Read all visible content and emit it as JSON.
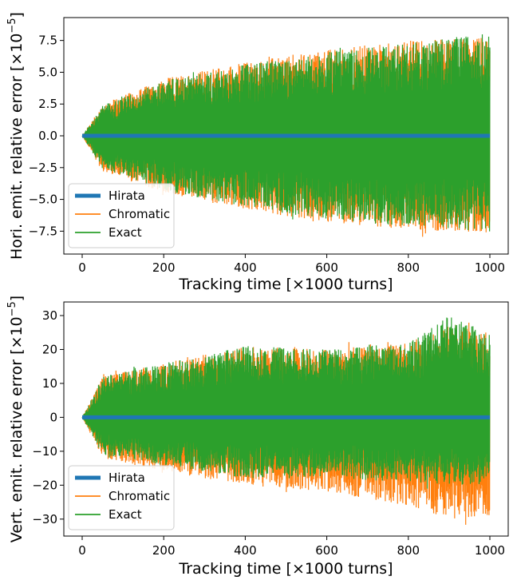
{
  "chart_data": [
    {
      "type": "line",
      "xlabel": "Tracking time [×1000 turns]",
      "ylabel": "Hori. emit. relative error [×10",
      "ylabel_exp": "−5",
      "ylabel_close": "]",
      "xlim": [
        -45,
        1045
      ],
      "ylim": [
        -9.3,
        9.3
      ],
      "xticks": [
        0,
        200,
        400,
        600,
        800,
        1000
      ],
      "xtick_labels": [
        "0",
        "200",
        "400",
        "600",
        "800",
        "1000"
      ],
      "yticks": [
        -7.5,
        -5.0,
        -2.5,
        0.0,
        2.5,
        5.0,
        7.5
      ],
      "ytick_labels": [
        "−7.5",
        "−5.0",
        "−2.5",
        "0.0",
        "2.5",
        "5.0",
        "7.5"
      ],
      "legend_position": "lower-left",
      "series": [
        {
          "name": "Hirata",
          "color": "#1f77b4",
          "values_summary": "constant 0 for x in [0, 1000]"
        },
        {
          "name": "Chromatic",
          "color": "#ff7f0e",
          "envelope": {
            "x": [
              0,
              50,
              200,
              400,
              600,
              800,
              1000
            ],
            "upper": [
              0,
              2.5,
              4.5,
              5.8,
              6.8,
              7.5,
              7.8
            ],
            "lower": [
              0,
              -2.8,
              -4.5,
              -5.8,
              -6.8,
              -7.4,
              -7.6
            ]
          }
        },
        {
          "name": "Exact",
          "color": "#2ca02c",
          "envelope": {
            "x": [
              0,
              50,
              200,
              400,
              600,
              800,
              1000
            ],
            "upper": [
              0,
              2.4,
              4.3,
              5.6,
              6.6,
              7.3,
              8.1
            ],
            "lower": [
              0,
              -2.6,
              -4.3,
              -5.6,
              -6.6,
              -7.2,
              -7.4
            ]
          }
        }
      ]
    },
    {
      "type": "line",
      "xlabel": "Tracking time [×1000 turns]",
      "ylabel": "Vert. emit. relative error [×10",
      "ylabel_exp": "−5",
      "ylabel_close": "]",
      "xlim": [
        -45,
        1045
      ],
      "ylim": [
        -35,
        34
      ],
      "xticks": [
        0,
        200,
        400,
        600,
        800,
        1000
      ],
      "xtick_labels": [
        "0",
        "200",
        "400",
        "600",
        "800",
        "1000"
      ],
      "yticks": [
        -30,
        -20,
        -10,
        0,
        10,
        20,
        30
      ],
      "ytick_labels": [
        "−30",
        "−20",
        "−10",
        "0",
        "10",
        "20",
        "30"
      ],
      "legend_position": "lower-left",
      "series": [
        {
          "name": "Hirata",
          "color": "#1f77b4",
          "values_summary": "constant 0 for x in [0, 1000]"
        },
        {
          "name": "Chromatic",
          "color": "#ff7f0e",
          "envelope": {
            "x": [
              0,
              50,
              200,
              400,
              600,
              800,
              900,
              1000
            ],
            "upper": [
              0,
              12,
              16,
              21,
              20,
              22,
              27,
              25
            ],
            "lower": [
              0,
              -12,
              -16,
              -20,
              -22,
              -26,
              -30,
              -29
            ]
          }
        },
        {
          "name": "Exact",
          "color": "#2ca02c",
          "envelope": {
            "x": [
              0,
              50,
              200,
              400,
              600,
              800,
              900,
              1000
            ],
            "upper": [
              0,
              12,
              16,
              21,
              20,
              22,
              30,
              25
            ],
            "lower": [
              0,
              -11,
              -14,
              -18,
              -18,
              -19,
              -20,
              -20
            ]
          }
        }
      ]
    }
  ]
}
